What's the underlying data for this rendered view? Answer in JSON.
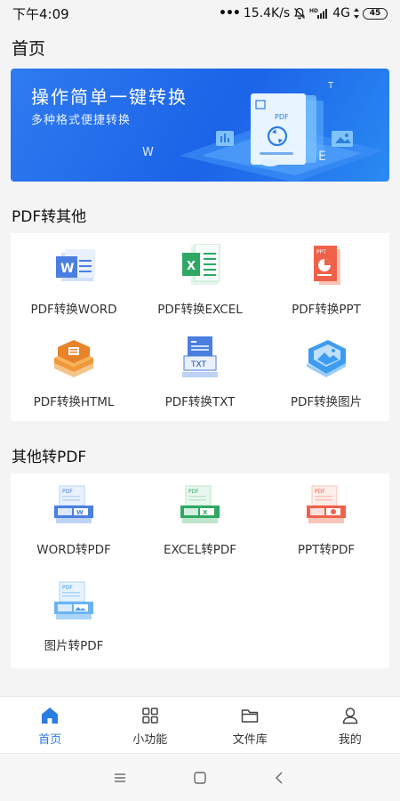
{
  "status": {
    "time": "下午4:09",
    "dots": "•••",
    "speed": "15.4K/s",
    "network": "4G",
    "battery": "45"
  },
  "header": {
    "title": "首页"
  },
  "banner": {
    "title": "操作简单一键转换",
    "subtitle": "多种格式便捷转换",
    "illustration_text": {
      "pdf": "PDF",
      "w": "W",
      "e": "E",
      "t": "T"
    }
  },
  "sections": [
    {
      "title": "PDF转其他",
      "items": [
        {
          "label": "PDF转换WORD",
          "icon": "word-icon",
          "badge": "W"
        },
        {
          "label": "PDF转换EXCEL",
          "icon": "excel-icon",
          "badge": "X"
        },
        {
          "label": "PDF转换PPT",
          "icon": "ppt-icon",
          "badge": "PPT"
        },
        {
          "label": "PDF转换HTML",
          "icon": "html-icon",
          "badge": ""
        },
        {
          "label": "PDF转换TXT",
          "icon": "txt-icon",
          "badge": "TXT"
        },
        {
          "label": "PDF转换图片",
          "icon": "image-icon",
          "badge": ""
        }
      ]
    },
    {
      "title": "其他转PDF",
      "items": [
        {
          "label": "WORD转PDF",
          "icon": "word-to-pdf-icon",
          "badge": "PDF"
        },
        {
          "label": "EXCEL转PDF",
          "icon": "excel-to-pdf-icon",
          "badge": "PDF"
        },
        {
          "label": "PPT转PDF",
          "icon": "ppt-to-pdf-icon",
          "badge": "PDF"
        },
        {
          "label": "图片转PDF",
          "icon": "image-to-pdf-icon",
          "badge": "PDF"
        }
      ]
    }
  ],
  "tabbar": {
    "items": [
      {
        "label": "首页",
        "icon": "home-icon",
        "active": true
      },
      {
        "label": "小功能",
        "icon": "grid-icon",
        "active": false
      },
      {
        "label": "文件库",
        "icon": "folder-icon",
        "active": false
      },
      {
        "label": "我的",
        "icon": "user-icon",
        "active": false
      }
    ]
  },
  "colors": {
    "accent": "#2a7de1",
    "word": "#4a7fe0",
    "excel": "#2fa864",
    "ppt": "#f0614a",
    "html": "#f0993a",
    "image": "#3d9cf0"
  }
}
